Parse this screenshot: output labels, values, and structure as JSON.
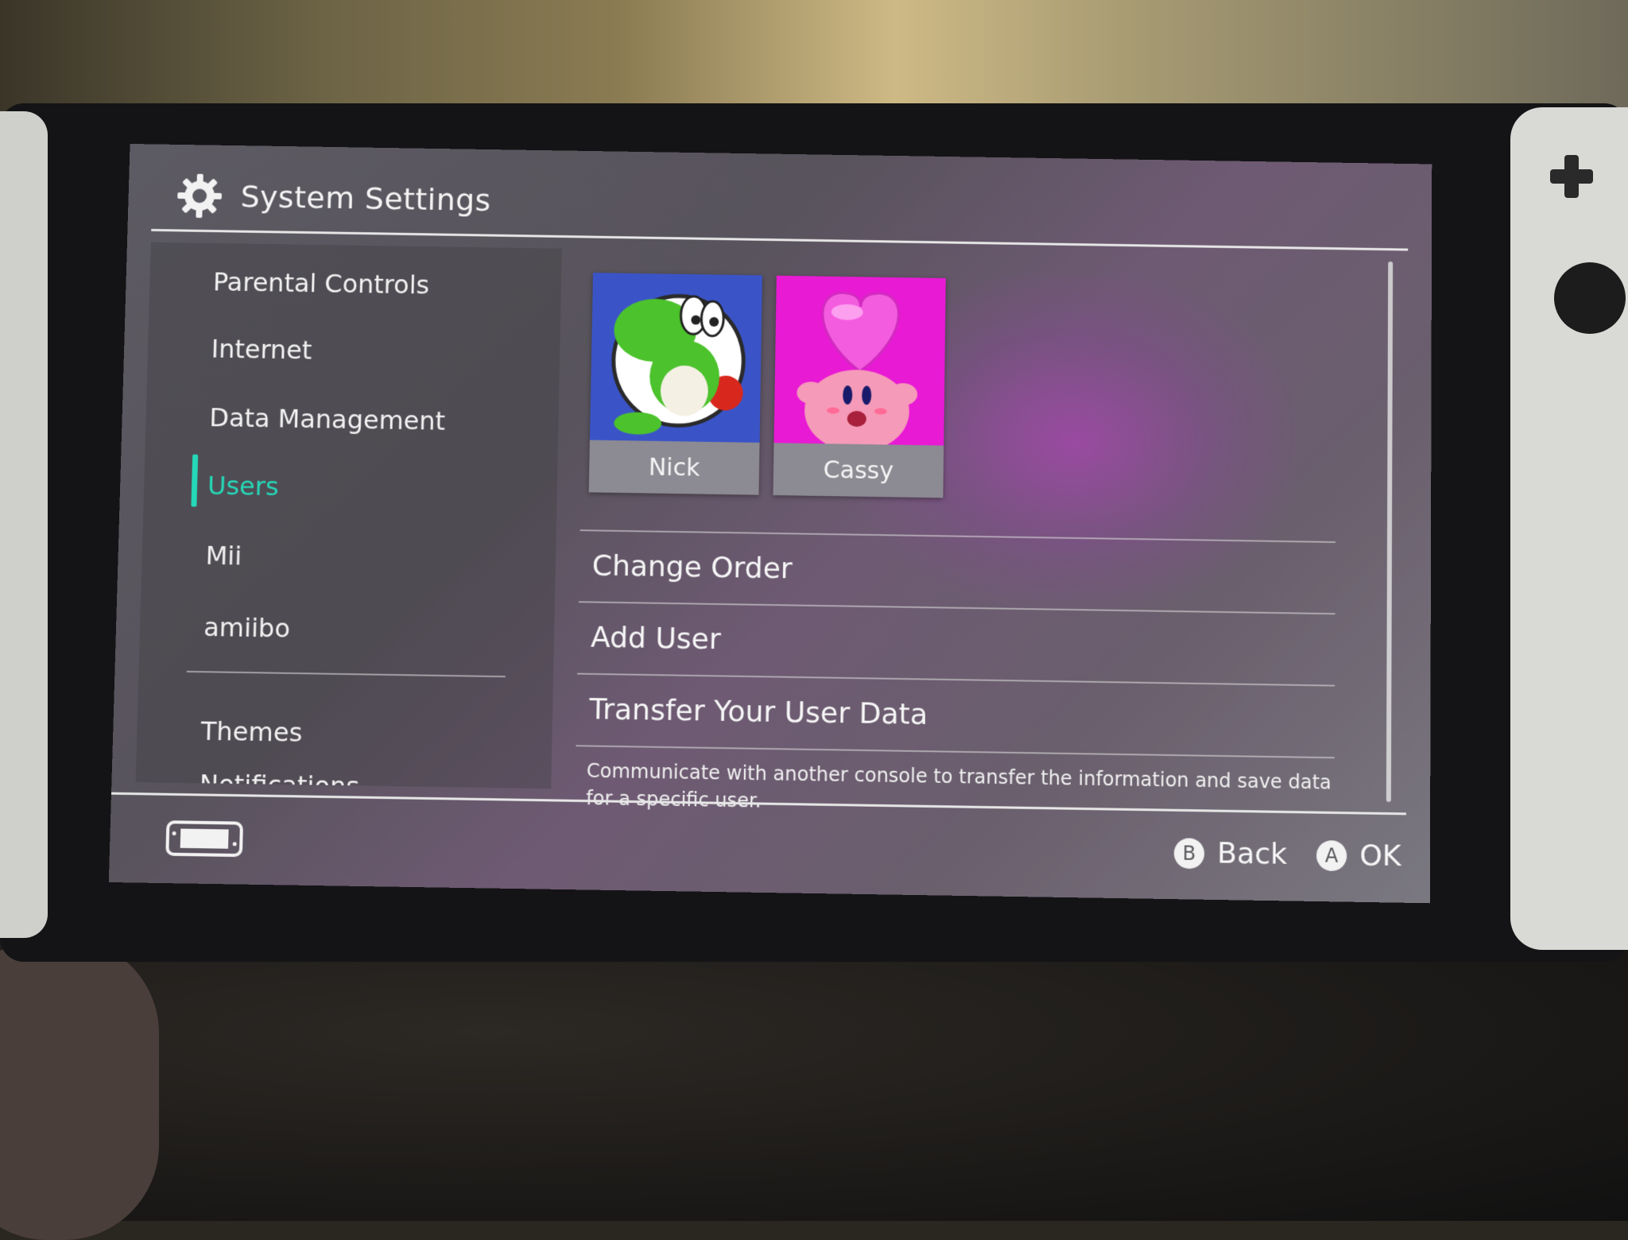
{
  "header": {
    "title": "System Settings",
    "icon": "gear-icon"
  },
  "sidebar": {
    "items": [
      {
        "label": "Parental Controls"
      },
      {
        "label": "Internet"
      },
      {
        "label": "Data Management"
      },
      {
        "label": "Users",
        "active": true
      },
      {
        "label": "Mii"
      },
      {
        "label": "amiibo"
      },
      {
        "label": "Themes"
      },
      {
        "label": "Notifications"
      }
    ]
  },
  "users": [
    {
      "name": "Nick",
      "icon": "yoshi-avatar"
    },
    {
      "name": "Cassy",
      "icon": "kirby-heart-avatar"
    }
  ],
  "menu": {
    "change_order": "Change Order",
    "add_user": "Add User",
    "transfer": "Transfer Your User Data",
    "transfer_description": "Communicate with another console to transfer the information and save data for a specific user."
  },
  "footer": {
    "back_button": "B",
    "back_label": "Back",
    "ok_button": "A",
    "ok_label": "OK"
  },
  "colors": {
    "accent": "#25d8b8",
    "screen_bg": "#5c5a62"
  }
}
